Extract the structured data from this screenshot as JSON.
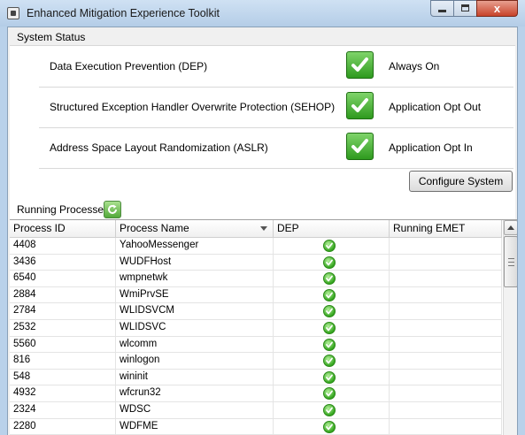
{
  "window": {
    "title": "Enhanced Mitigation Experience Toolkit",
    "close_glyph": "x"
  },
  "system_status": {
    "label": "System Status",
    "items": [
      {
        "label": "Data Execution Prevention (DEP)",
        "value": "Always On"
      },
      {
        "label": "Structured Exception Handler Overwrite Protection (SEHOP)",
        "value": "Application Opt Out"
      },
      {
        "label": "Address Space Layout Randomization (ASLR)",
        "value": "Application Opt In"
      }
    ],
    "configure_button": "Configure System"
  },
  "running_processes": {
    "label": "Running Processes",
    "columns": [
      "Process ID",
      "Process Name",
      "DEP",
      "Running EMET"
    ],
    "rows": [
      {
        "pid": "4408",
        "name": "YahooMessenger"
      },
      {
        "pid": "3436",
        "name": "WUDFHost"
      },
      {
        "pid": "6540",
        "name": "wmpnetwk"
      },
      {
        "pid": "2884",
        "name": "WmiPrvSE"
      },
      {
        "pid": "2784",
        "name": "WLIDSVCM"
      },
      {
        "pid": "2532",
        "name": "WLIDSVC"
      },
      {
        "pid": "5560",
        "name": "wlcomm"
      },
      {
        "pid": "816",
        "name": "winlogon"
      },
      {
        "pid": "548",
        "name": "wininit"
      },
      {
        "pid": "4932",
        "name": "wfcrun32"
      },
      {
        "pid": "2324",
        "name": "WDSC"
      },
      {
        "pid": "2280",
        "name": "WDFME"
      }
    ]
  }
}
